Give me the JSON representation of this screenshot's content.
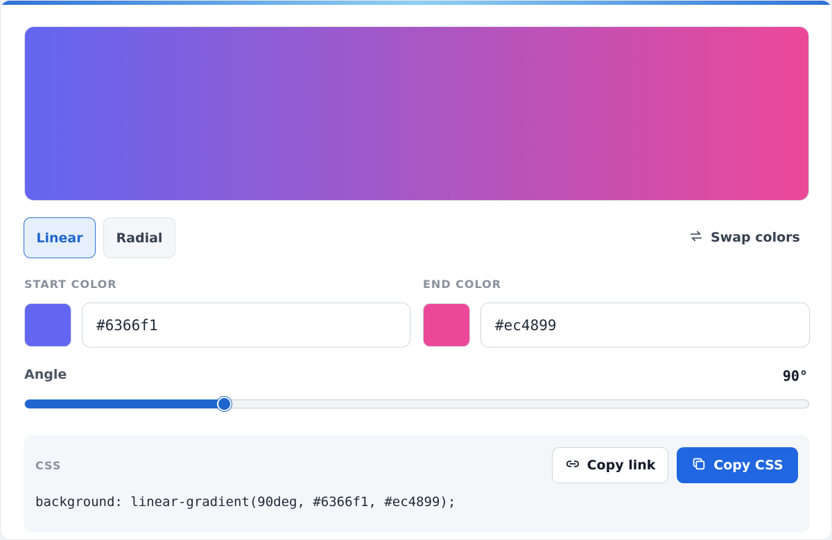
{
  "gradient": {
    "mode": "linear",
    "start_color": "#6366f1",
    "end_color": "#ec4899",
    "angle_deg": 90,
    "angle_min": 0,
    "angle_max": 360
  },
  "tabs": [
    {
      "label": "Linear",
      "active": true
    },
    {
      "label": "Radial",
      "active": false
    }
  ],
  "swap": {
    "label": "Swap colors",
    "icon": "swap-icon"
  },
  "start": {
    "label": "START COLOR",
    "value": "#6366f1"
  },
  "end": {
    "label": "END COLOR",
    "value": "#ec4899"
  },
  "angle": {
    "label": "Angle",
    "display": "90°"
  },
  "css": {
    "label": "CSS",
    "code": "background: linear-gradient(90deg, #6366f1, #ec4899);",
    "copy_link_label": "Copy link",
    "copy_link_icon": "link-icon",
    "copy_css_label": "Copy CSS",
    "copy_css_icon": "copy-icon"
  },
  "colors": {
    "accent": "#1f66cf",
    "primary_button": "#1f66e0"
  }
}
